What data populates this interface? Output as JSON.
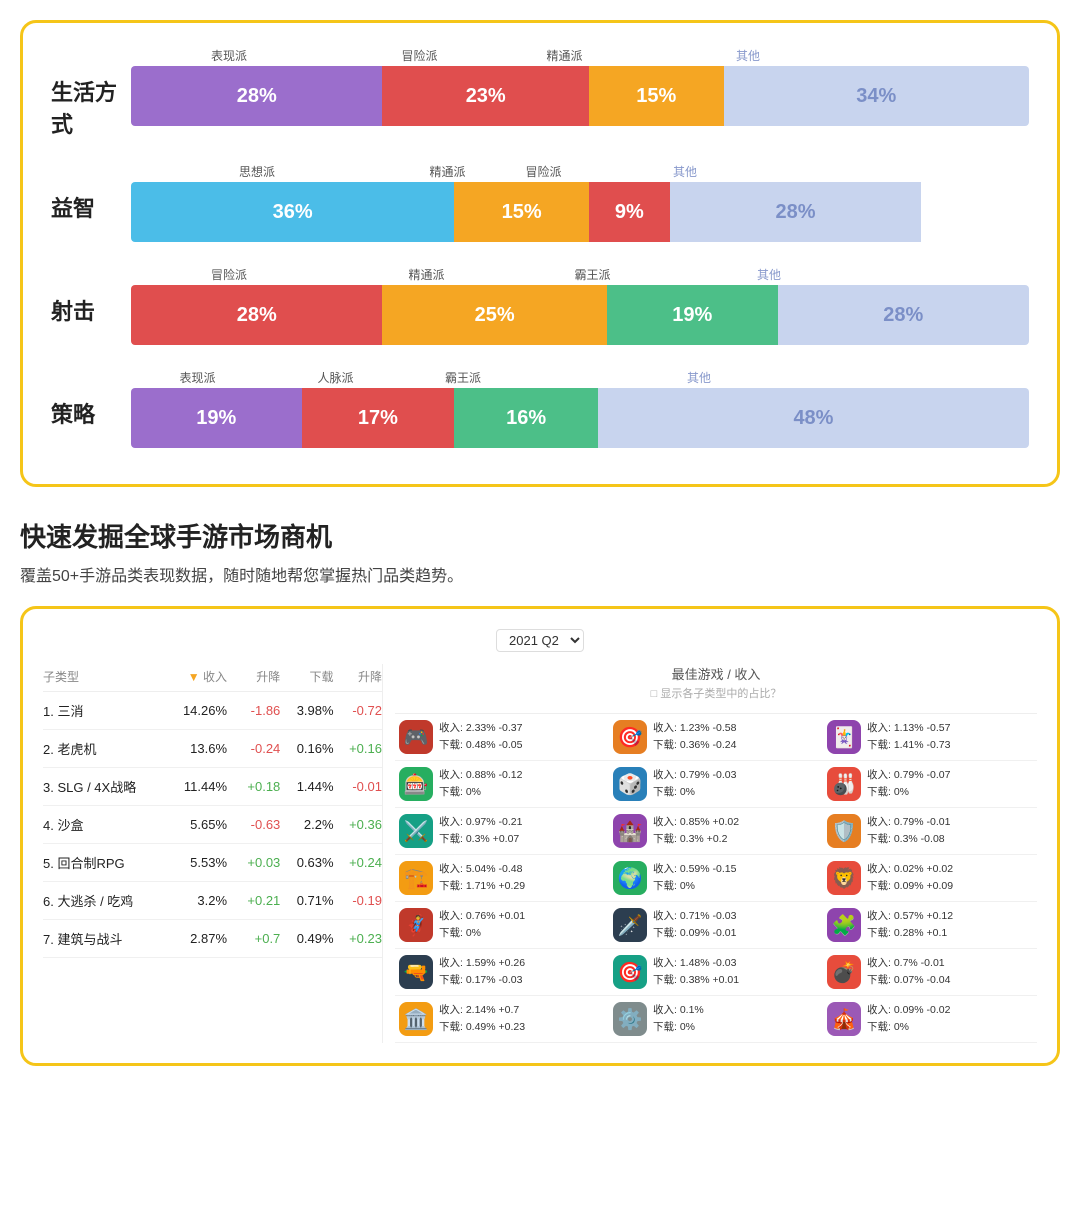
{
  "topCard": {
    "rows": [
      {
        "label": "生活方式",
        "legends": [
          "表现派",
          "冒险派",
          "精通派",
          "其他"
        ],
        "segments": [
          {
            "pct": 28,
            "label": "28%",
            "color": "#9B6ECC",
            "emoji": "🧙"
          },
          {
            "pct": 23,
            "label": "23%",
            "color": "#E04E4E",
            "emoji": "🏎"
          },
          {
            "pct": 15,
            "label": "15%",
            "color": "#F5A623",
            "emoji": "🥋"
          },
          {
            "pct": 34,
            "label": "34%",
            "color": "#C8D4EE",
            "isOther": true
          }
        ]
      },
      {
        "label": "益智",
        "legends": [
          "思想派",
          "精通派",
          "冒险派",
          "其他"
        ],
        "segments": [
          {
            "pct": 36,
            "label": "36%",
            "color": "#4BBDE8",
            "emoji": "💡"
          },
          {
            "pct": 15,
            "label": "15%",
            "color": "#F5A623",
            "emoji": "🥋"
          },
          {
            "pct": 9,
            "label": "9%",
            "color": "#E04E4E",
            "emoji": "🏎"
          },
          {
            "pct": 28,
            "label": "28%",
            "color": "#C8D4EE",
            "isOther": true
          }
        ]
      },
      {
        "label": "射击",
        "legends": [
          "冒险派",
          "精通派",
          "霸王派",
          "其他"
        ],
        "segments": [
          {
            "pct": 28,
            "label": "28%",
            "color": "#E04E4E",
            "emoji": "🏎"
          },
          {
            "pct": 25,
            "label": "25%",
            "color": "#F5A623",
            "emoji": "🥋"
          },
          {
            "pct": 19,
            "label": "19%",
            "color": "#4CBF88",
            "emoji": "🪖"
          },
          {
            "pct": 28,
            "label": "28%",
            "color": "#C8D4EE",
            "isOther": true
          }
        ]
      },
      {
        "label": "策略",
        "legends": [
          "表现派",
          "人脉派",
          "霸王派",
          "其他"
        ],
        "segments": [
          {
            "pct": 19,
            "label": "19%",
            "color": "#9B6ECC",
            "emoji": "🧙"
          },
          {
            "pct": 17,
            "label": "17%",
            "color": "#E04E4E",
            "emoji": "🧑"
          },
          {
            "pct": 16,
            "label": "16%",
            "color": "#4CBF88",
            "emoji": "🪖"
          },
          {
            "pct": 48,
            "label": "48%",
            "color": "#C8D4EE",
            "isOther": true
          }
        ]
      }
    ]
  },
  "heading": {
    "title": "快速发掘全球手游市场商机",
    "subtitle": "覆盖50+手游品类表现数据，随时随地帮您掌握热门品类趋势。"
  },
  "bottomCard": {
    "quarter": "2021 Q2",
    "colHeaders": {
      "subtype": "子类型",
      "rev": "收入",
      "revChg": "升降",
      "dl": "下载",
      "dlChg": "升降"
    },
    "rightHeader": "最佳游戏 / 收入",
    "showPctLabel": "□ 显示各子类型中的占比？",
    "rows": [
      {
        "rank": "1.",
        "name": "三消",
        "rev": "14.26%",
        "revChg": "-1.86",
        "dl": "3.98%",
        "dlChg": "-0.72",
        "games": [
          {
            "icon": "🎮",
            "iconBg": "#c0392b",
            "stats": "收入: 2.33% -0.37\n下载: 0.48% -0.05"
          },
          {
            "icon": "🎯",
            "iconBg": "#e67e22",
            "stats": "收入: 1.23% -0.58\n下载: 0.36% -0.24"
          },
          {
            "icon": "🃏",
            "iconBg": "#8e44ad",
            "stats": "收入: 1.13% -0.57\n下载: 1.41% -0.73"
          }
        ]
      },
      {
        "rank": "2.",
        "name": "老虎机",
        "rev": "13.6%",
        "revChg": "-0.24",
        "dl": "0.16%",
        "dlChg": "+0.16",
        "games": [
          {
            "icon": "🎰",
            "iconBg": "#27ae60",
            "stats": "收入: 0.88% -0.12\n下载: 0%"
          },
          {
            "icon": "🎲",
            "iconBg": "#2980b9",
            "stats": "收入: 0.79% -0.03\n下载: 0%"
          },
          {
            "icon": "🎳",
            "iconBg": "#e74c3c",
            "stats": "收入: 0.79% -0.07\n下载: 0%"
          }
        ]
      },
      {
        "rank": "3.",
        "name": "SLG / 4X战略",
        "rev": "11.44%",
        "revChg": "+0.18",
        "dl": "1.44%",
        "dlChg": "-0.01",
        "games": [
          {
            "icon": "⚔️",
            "iconBg": "#16a085",
            "stats": "收入: 0.97% -0.21\n下载: 0.3% +0.07"
          },
          {
            "icon": "🏰",
            "iconBg": "#8e44ad",
            "stats": "收入: 0.85% +0.02\n下载: 0.3% +0.2"
          },
          {
            "icon": "🛡️",
            "iconBg": "#e67e22",
            "stats": "收入: 0.79% -0.01\n下载: 0.3% -0.08"
          }
        ]
      },
      {
        "rank": "4.",
        "name": "沙盒",
        "rev": "5.65%",
        "revChg": "-0.63",
        "dl": "2.2%",
        "dlChg": "+0.36",
        "games": [
          {
            "icon": "🏗️",
            "iconBg": "#f39c12",
            "stats": "收入: 5.04% -0.48\n下载: 1.71% +0.29"
          },
          {
            "icon": "🌍",
            "iconBg": "#27ae60",
            "stats": "收入: 0.59% -0.15\n下载: 0%"
          },
          {
            "icon": "🦁",
            "iconBg": "#e74c3c",
            "stats": "收入: 0.02% +0.02\n下载: 0.09% +0.09"
          }
        ]
      },
      {
        "rank": "5.",
        "name": "回合制RPG",
        "rev": "5.53%",
        "revChg": "+0.03",
        "dl": "0.63%",
        "dlChg": "+0.24",
        "games": [
          {
            "icon": "🦸",
            "iconBg": "#c0392b",
            "stats": "收入: 0.76% +0.01\n下载: 0%"
          },
          {
            "icon": "🗡️",
            "iconBg": "#2c3e50",
            "stats": "收入: 0.71% -0.03\n下载: 0.09% -0.01"
          },
          {
            "icon": "🧩",
            "iconBg": "#8e44ad",
            "stats": "收入: 0.57% +0.12\n下载: 0.28% +0.1"
          }
        ]
      },
      {
        "rank": "6.",
        "name": "大逃杀 / 吃鸡",
        "rev": "3.2%",
        "revChg": "+0.21",
        "dl": "0.71%",
        "dlChg": "-0.19",
        "games": [
          {
            "icon": "🔫",
            "iconBg": "#2c3e50",
            "stats": "收入: 1.59% +0.26\n下载: 0.17% -0.03"
          },
          {
            "icon": "🎯",
            "iconBg": "#16a085",
            "stats": "收入: 1.48% -0.03\n下载: 0.38% +0.01"
          },
          {
            "icon": "💣",
            "iconBg": "#e74c3c",
            "stats": "收入: 0.7% -0.01\n下载: 0.07% -0.04"
          }
        ]
      },
      {
        "rank": "7.",
        "name": "建筑与战斗",
        "rev": "2.87%",
        "revChg": "+0.7",
        "dl": "0.49%",
        "dlChg": "+0.23",
        "games": [
          {
            "icon": "🏛️",
            "iconBg": "#f39c12",
            "stats": "收入: 2.14% +0.7\n下载: 0.49% +0.23"
          },
          {
            "icon": "⚙️",
            "iconBg": "#7f8c8d",
            "stats": "收入: 0.1%\n下载: 0%"
          },
          {
            "icon": "🎪",
            "iconBg": "#9b59b6",
            "stats": "收入: 0.09% -0.02\n下载: 0%"
          }
        ]
      }
    ]
  }
}
